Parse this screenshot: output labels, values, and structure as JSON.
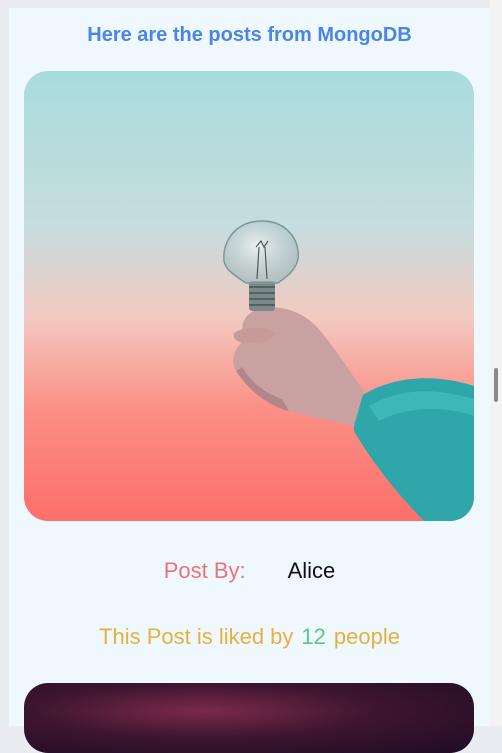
{
  "header": {
    "title": "Here are the posts from MongoDB"
  },
  "posts": [
    {
      "image": "lightbulb-in-hand",
      "by_label": "Post By:",
      "author": "Alice",
      "likes_prefix": "This Post is liked by",
      "likes_count": "12",
      "likes_suffix": "people"
    },
    {
      "image": "dark-smoke"
    }
  ],
  "colors": {
    "heading": "#4a86e8",
    "by_label": "#ee7373",
    "likes_text": "#e3b23c",
    "likes_count": "#5cc77e",
    "background": "#f0f8ff"
  }
}
